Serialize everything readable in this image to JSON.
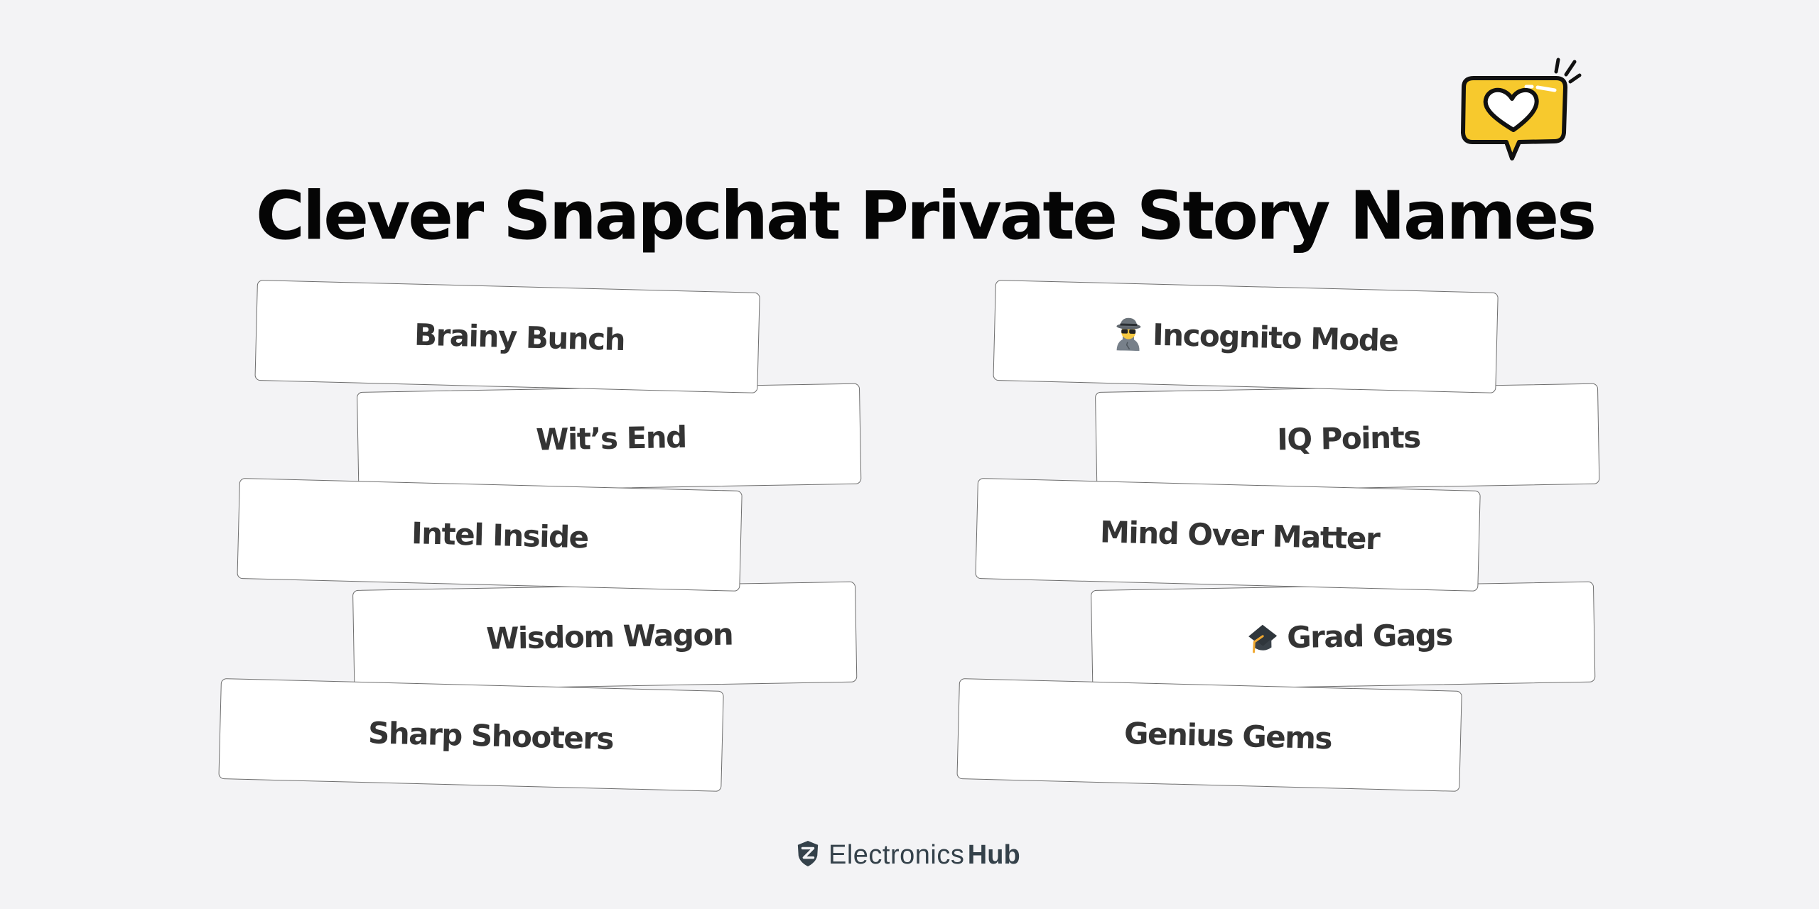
{
  "title": "Clever Snapchat Private Story Names",
  "header_icon": "heart-speech-bubble-icon",
  "colors": {
    "background": "#f3f3f5",
    "title": "#050505",
    "card_text": "#343434",
    "card_border": "#6e6e6e",
    "bubble_yellow": "#f7c92d",
    "brand": "#34414a"
  },
  "columns": [
    {
      "cards": [
        {
          "label": "Brainy Bunch",
          "emoji": null
        },
        {
          "label": "Wit’s End",
          "emoji": null
        },
        {
          "label": "Intel Inside",
          "emoji": null
        },
        {
          "label": "Wisdom Wagon",
          "emoji": null
        },
        {
          "label": "Sharp Shooters",
          "emoji": null
        }
      ]
    },
    {
      "cards": [
        {
          "label": "Incognito Mode",
          "emoji": "detective-icon"
        },
        {
          "label": "IQ Points",
          "emoji": null
        },
        {
          "label": "Mind Over Matter",
          "emoji": null
        },
        {
          "label": "Grad Gags",
          "emoji": "graduation-cap-icon"
        },
        {
          "label": "Genius Gems",
          "emoji": null
        }
      ]
    }
  ],
  "footer": {
    "logo_icon": "shield-logo-icon",
    "brand_light": "Electronics",
    "brand_bold": "Hub"
  }
}
